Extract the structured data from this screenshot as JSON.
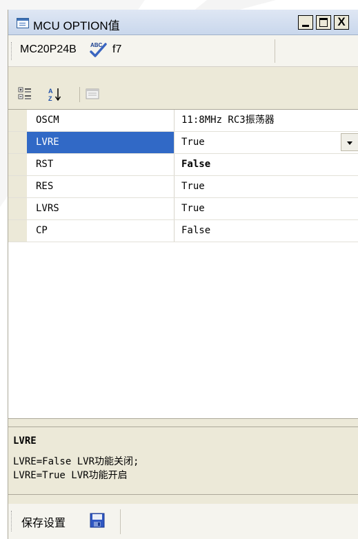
{
  "window": {
    "title": "MCU OPTION值"
  },
  "toolbar": {
    "chip_model": "MC20P24B",
    "frequency": "f7",
    "icons": [
      "spell-check-icon",
      "categorized-view-icon",
      "alphabetical-sort-icon",
      "property-pages-icon"
    ]
  },
  "properties": [
    {
      "name": "OSCM",
      "value": "11:8MHz RC3振荡器"
    },
    {
      "name": "LVRE",
      "value": "True"
    },
    {
      "name": "RST",
      "value": "False"
    },
    {
      "name": "RES",
      "value": "True"
    },
    {
      "name": "LVRS",
      "value": "True"
    },
    {
      "name": "CP",
      "value": "False"
    }
  ],
  "description": {
    "title": "LVRE",
    "lines": [
      "LVRE=False LVR功能关闭;",
      "LVRE=True LVR功能开启"
    ]
  },
  "footer": {
    "save_label": "保存设置",
    "save_icon": "floppy-disk-icon"
  },
  "colors": {
    "selection": "#3169c6",
    "window_bg": "#ece9d8"
  }
}
